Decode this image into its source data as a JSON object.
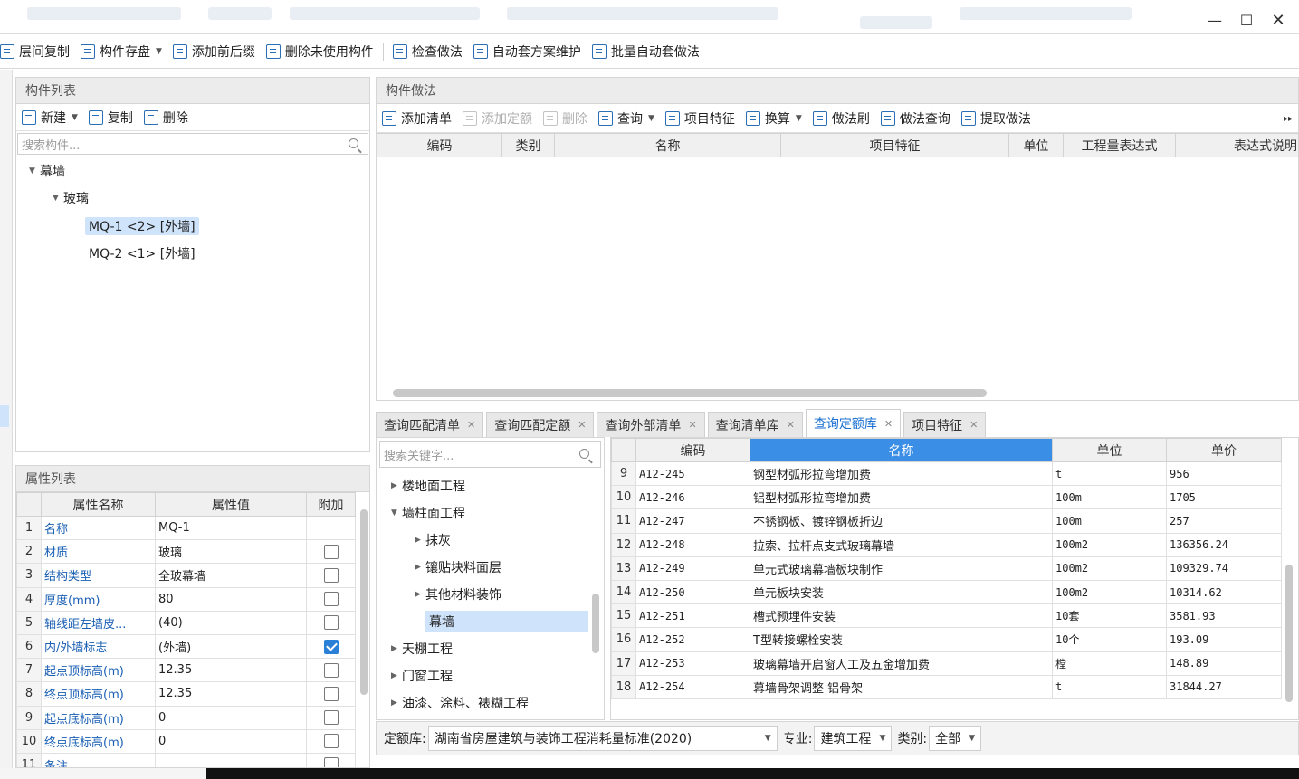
{
  "toolbar": {
    "items": [
      {
        "label": "层间复制",
        "caret": false
      },
      {
        "label": "构件存盘",
        "caret": true
      },
      {
        "label": "添加前后缀",
        "caret": false
      },
      {
        "label": "删除未使用构件",
        "caret": false
      },
      {
        "label": "检查做法",
        "caret": false
      },
      {
        "label": "自动套方案维护",
        "caret": false
      },
      {
        "label": "批量自动套做法",
        "caret": false
      }
    ]
  },
  "component_list": {
    "title": "构件列表",
    "new_label": "新建",
    "copy_label": "复制",
    "delete_label": "删除",
    "search_placeholder": "搜索构件...",
    "tree": {
      "root": "幕墙",
      "child": "玻璃",
      "items": [
        "MQ-1 <2> [外墙]",
        "MQ-2 <1> [外墙]"
      ]
    }
  },
  "property_list": {
    "title": "属性列表",
    "headers": [
      "属性名称",
      "属性值",
      "附加"
    ],
    "rows": [
      {
        "n": "1",
        "name": "名称",
        "value": "MQ-1",
        "checkbox": "none"
      },
      {
        "n": "2",
        "name": "材质",
        "value": "玻璃",
        "checkbox": "off"
      },
      {
        "n": "3",
        "name": "结构类型",
        "value": "全玻幕墙",
        "checkbox": "off"
      },
      {
        "n": "4",
        "name": "厚度(mm)",
        "value": "80",
        "checkbox": "off"
      },
      {
        "n": "5",
        "name": "轴线距左墙皮...",
        "value": "(40)",
        "checkbox": "off"
      },
      {
        "n": "6",
        "name": "内/外墙标志",
        "value": "(外墙)",
        "checkbox": "on"
      },
      {
        "n": "7",
        "name": "起点顶标高(m)",
        "value": "12.35",
        "checkbox": "off"
      },
      {
        "n": "8",
        "name": "终点顶标高(m)",
        "value": "12.35",
        "checkbox": "off"
      },
      {
        "n": "9",
        "name": "起点底标高(m)",
        "value": "0",
        "checkbox": "off"
      },
      {
        "n": "10",
        "name": "终点底标高(m)",
        "value": "0",
        "checkbox": "off"
      },
      {
        "n": "11",
        "name": "备注",
        "value": "",
        "checkbox": "off"
      }
    ]
  },
  "method": {
    "title": "构件做法",
    "toolbar": [
      {
        "label": "添加清单",
        "disabled": false,
        "caret": false
      },
      {
        "label": "添加定额",
        "disabled": true,
        "caret": false
      },
      {
        "label": "删除",
        "disabled": true,
        "caret": false
      },
      {
        "label": "查询",
        "disabled": false,
        "caret": true
      },
      {
        "label": "项目特征",
        "disabled": false,
        "caret": false
      },
      {
        "label": "换算",
        "disabled": false,
        "caret": true
      },
      {
        "label": "做法刷",
        "disabled": false,
        "caret": false
      },
      {
        "label": "做法查询",
        "disabled": false,
        "caret": false
      },
      {
        "label": "提取做法",
        "disabled": false,
        "caret": false
      }
    ],
    "headers": [
      "编码",
      "类别",
      "名称",
      "项目特征",
      "单位",
      "工程量表达式",
      "表达式说明"
    ]
  },
  "query_tabs": {
    "tabs": [
      "查询匹配清单",
      "查询匹配定额",
      "查询外部清单",
      "查询清单库",
      "查询定额库",
      "项目特征"
    ],
    "active": 4
  },
  "category_tree": {
    "search_placeholder": "搜索关键字...",
    "items": [
      {
        "label": "楼地面工程",
        "level": 0,
        "expanded": false,
        "selected": false
      },
      {
        "label": "墙柱面工程",
        "level": 0,
        "expanded": true,
        "selected": false
      },
      {
        "label": "抹灰",
        "level": 1,
        "expanded": false,
        "selected": false
      },
      {
        "label": "镶贴块料面层",
        "level": 1,
        "expanded": false,
        "selected": false
      },
      {
        "label": "其他材料装饰",
        "level": 1,
        "expanded": false,
        "selected": false
      },
      {
        "label": "幕墙",
        "level": 1,
        "expanded": null,
        "selected": true
      },
      {
        "label": "天棚工程",
        "level": 0,
        "expanded": false,
        "selected": false
      },
      {
        "label": "门窗工程",
        "level": 0,
        "expanded": false,
        "selected": false
      },
      {
        "label": "油漆、涂料、裱糊工程",
        "level": 0,
        "expanded": false,
        "selected": false
      }
    ]
  },
  "quota_table": {
    "headers": [
      "编码",
      "名称",
      "单位",
      "单价"
    ],
    "rows": [
      {
        "n": "9",
        "code": "A12-245",
        "name": "钢型材弧形拉弯增加费",
        "unit": "t",
        "price": "956"
      },
      {
        "n": "10",
        "code": "A12-246",
        "name": "铝型材弧形拉弯增加费",
        "unit": "100m",
        "price": "1705"
      },
      {
        "n": "11",
        "code": "A12-247",
        "name": "不锈钢板、镀锌钢板折边",
        "unit": "100m",
        "price": "257"
      },
      {
        "n": "12",
        "code": "A12-248",
        "name": "拉索、拉杆点支式玻璃幕墙",
        "unit": "100m2",
        "price": "136356.24"
      },
      {
        "n": "13",
        "code": "A12-249",
        "name": "单元式玻璃幕墙板块制作",
        "unit": "100m2",
        "price": "109329.74"
      },
      {
        "n": "14",
        "code": "A12-250",
        "name": "单元板块安装",
        "unit": "100m2",
        "price": "10314.62"
      },
      {
        "n": "15",
        "code": "A12-251",
        "name": "槽式预埋件安装",
        "unit": "10套",
        "price": "3581.93"
      },
      {
        "n": "16",
        "code": "A12-252",
        "name": "T型转接螺栓安装",
        "unit": "10个",
        "price": "193.09"
      },
      {
        "n": "17",
        "code": "A12-253",
        "name": "玻璃幕墙开启窗人工及五金增加费",
        "unit": "樘",
        "price": "148.89"
      },
      {
        "n": "18",
        "code": "A12-254",
        "name": "幕墙骨架调整 铝骨架",
        "unit": "t",
        "price": "31844.27"
      }
    ]
  },
  "filters": {
    "library_label": "定额库:",
    "library_value": "湖南省房屋建筑与装饰工程消耗量标准(2020)",
    "specialty_label": "专业:",
    "specialty_value": "建筑工程",
    "category_label": "类别:",
    "category_value": "全部"
  }
}
